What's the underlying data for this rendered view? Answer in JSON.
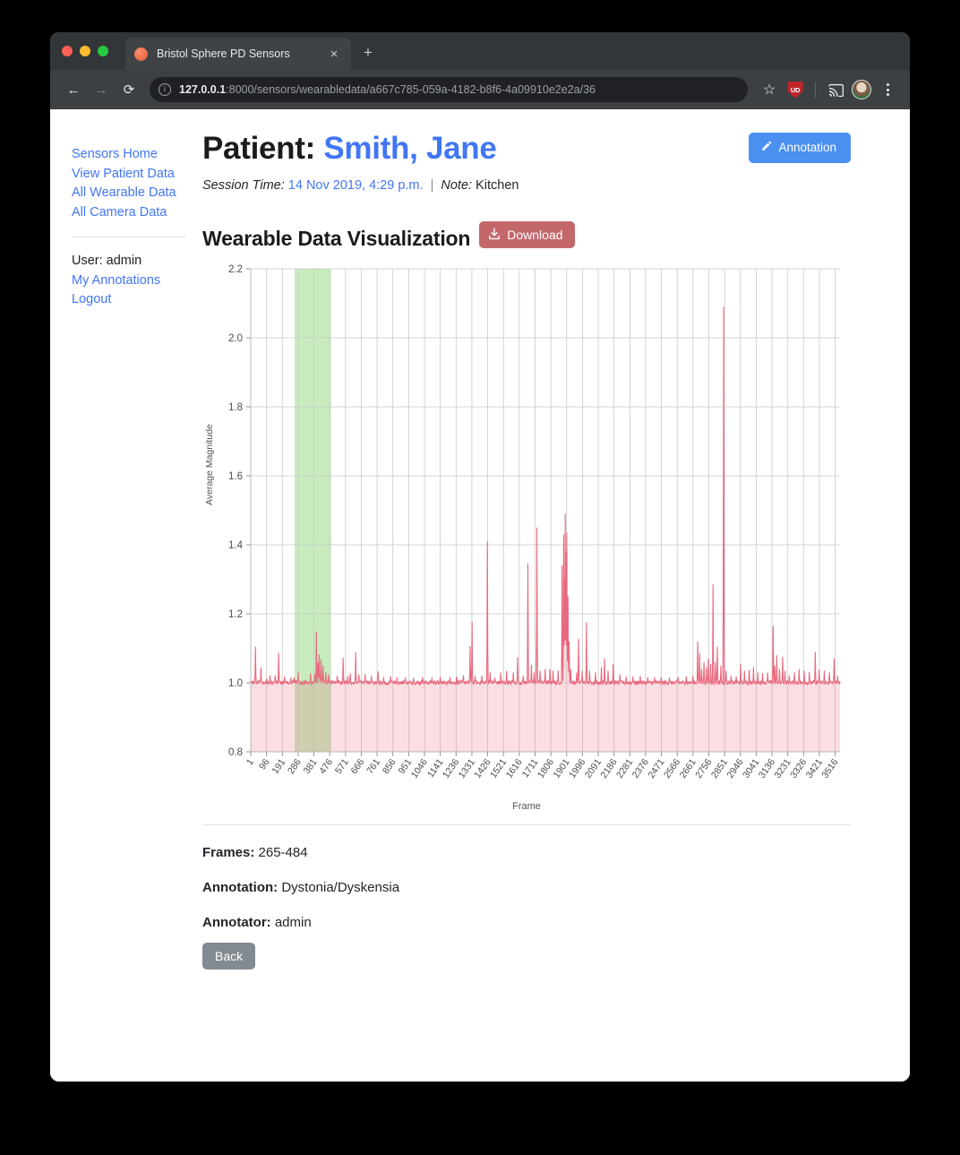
{
  "browser": {
    "tab_title": "Bristol Sphere PD Sensors",
    "tab_close": "×",
    "new_tab": "+",
    "back": "←",
    "forward": "→",
    "reload": "⟳",
    "url_host": "127.0.0.1",
    "url_rest": ":8000/sensors/wearabledata/a667c785-059a-4182-b8f6-4a09910e2e2a/36",
    "star": "☆",
    "extension_badge": "UD",
    "cast": "cast-icon",
    "menu": "kebab-menu"
  },
  "sidebar": {
    "links": [
      {
        "label": "Sensors Home"
      },
      {
        "label": "View Patient Data"
      },
      {
        "label": "All Wearable Data"
      },
      {
        "label": "All Camera Data"
      }
    ],
    "user_line": "User: admin",
    "my_annotations": "My Annotations",
    "logout": "Logout"
  },
  "header": {
    "patient_prefix": "Patient:",
    "patient_name": "Smith, Jane",
    "annotation_button": "Annotation",
    "session_label": "Session Time:",
    "session_time": "14 Nov 2019, 4:29 p.m.",
    "separator": "|",
    "note_label": "Note:",
    "note_value": "Kitchen"
  },
  "viz": {
    "title": "Wearable Data Visualization",
    "download_button": "Download"
  },
  "details": {
    "frames_label": "Frames:",
    "frames_value": "265-484",
    "annotation_label": "Annotation:",
    "annotation_value": "Dystonia/Dyskensia",
    "annotator_label": "Annotator:",
    "annotator_value": "admin",
    "back_button": "Back"
  },
  "colors": {
    "link_blue": "#4176f4",
    "annotation_blue": "#4b90f0",
    "download_red": "#c4676b",
    "back_gray": "#838a91",
    "series_line": "#e8697d",
    "series_fill": "#f7dcdf",
    "highlight_green": "#b6e6a8"
  },
  "chart_data": {
    "type": "line",
    "title": "",
    "xlabel": "Frame",
    "ylabel": "Average Magnitude",
    "ylim": [
      0.8,
      2.2
    ],
    "yticks": [
      0.8,
      1.0,
      1.2,
      1.4,
      1.6,
      1.8,
      2.0,
      2.2
    ],
    "ytick_labels": [
      "0.8",
      "1.0",
      "1.2",
      "1.4",
      "1.6",
      "1.8",
      "2.0",
      "2.2"
    ],
    "xlim": [
      1,
      3545
    ],
    "xticks": [
      1,
      96,
      191,
      286,
      381,
      476,
      571,
      666,
      761,
      856,
      951,
      1046,
      1141,
      1236,
      1331,
      1426,
      1521,
      1616,
      1711,
      1806,
      1901,
      1996,
      2091,
      2186,
      2281,
      2376,
      2471,
      2566,
      2661,
      2756,
      2851,
      2946,
      3041,
      3136,
      3231,
      3326,
      3421,
      3516
    ],
    "xtick_labels": [
      "1",
      "96",
      "191",
      "286",
      "381",
      "476",
      "571",
      "666",
      "761",
      "856",
      "951",
      "1046",
      "1141",
      "1236",
      "1331",
      "1426",
      "1521",
      "1616",
      "1711",
      "1806",
      "1901",
      "1996",
      "2091",
      "2186",
      "2281",
      "2376",
      "2471",
      "2566",
      "2661",
      "2756",
      "2851",
      "2946",
      "3041",
      "3136",
      "3231",
      "3326",
      "3421",
      "3516"
    ],
    "grid": true,
    "legend": null,
    "baseline": 1.0,
    "fill_to": 0.8,
    "highlight_region": {
      "start": 265,
      "end": 484,
      "color": "#b6e6a8",
      "label": "annotated frames 265-484"
    },
    "series": [
      {
        "name": "Average Magnitude",
        "color": "#e8697d",
        "peaks": [
          [
            30,
            1.105
          ],
          [
            63,
            1.045
          ],
          [
            97,
            1.012
          ],
          [
            118,
            1.022
          ],
          [
            148,
            1.022
          ],
          [
            168,
            1.087
          ],
          [
            205,
            1.018
          ],
          [
            243,
            1.015
          ],
          [
            262,
            1.016
          ],
          [
            288,
            1.03
          ],
          [
            330,
            1.008
          ],
          [
            360,
            1.028
          ],
          [
            387,
            1.025
          ],
          [
            395,
            1.148
          ],
          [
            405,
            1.06
          ],
          [
            412,
            1.082
          ],
          [
            424,
            1.068
          ],
          [
            437,
            1.05
          ],
          [
            452,
            1.03
          ],
          [
            470,
            1.024
          ],
          [
            520,
            1.02
          ],
          [
            556,
            1.072
          ],
          [
            584,
            1.02
          ],
          [
            600,
            1.028
          ],
          [
            633,
            1.088
          ],
          [
            650,
            1.024
          ],
          [
            690,
            1.025
          ],
          [
            726,
            1.02
          ],
          [
            766,
            1.033
          ],
          [
            800,
            1.016
          ],
          [
            842,
            1.019
          ],
          [
            880,
            1.016
          ],
          [
            930,
            1.015
          ],
          [
            980,
            1.014
          ],
          [
            1035,
            1.016
          ],
          [
            1090,
            1.015
          ],
          [
            1140,
            1.017
          ],
          [
            1200,
            1.016
          ],
          [
            1240,
            1.018
          ],
          [
            1280,
            1.022
          ],
          [
            1320,
            1.106
          ],
          [
            1333,
            1.178
          ],
          [
            1352,
            1.02
          ],
          [
            1390,
            1.02
          ],
          [
            1424,
            1.41
          ],
          [
            1440,
            1.03
          ],
          [
            1470,
            1.015
          ],
          [
            1505,
            1.03
          ],
          [
            1540,
            1.035
          ],
          [
            1580,
            1.03
          ],
          [
            1606,
            1.075
          ],
          [
            1640,
            1.02
          ],
          [
            1668,
            1.346
          ],
          [
            1690,
            1.052
          ],
          [
            1705,
            1.03
          ],
          [
            1722,
            1.45
          ],
          [
            1740,
            1.035
          ],
          [
            1772,
            1.04
          ],
          [
            1800,
            1.04
          ],
          [
            1820,
            1.035
          ],
          [
            1850,
            1.035
          ],
          [
            1874,
            1.34
          ],
          [
            1882,
            1.43
          ],
          [
            1888,
            1.3
          ],
          [
            1893,
            1.49
          ],
          [
            1898,
            1.38
          ],
          [
            1903,
            1.435
          ],
          [
            1908,
            1.25
          ],
          [
            1915,
            1.12
          ],
          [
            1925,
            1.04
          ],
          [
            1960,
            1.03
          ],
          [
            1972,
            1.128
          ],
          [
            1995,
            1.035
          ],
          [
            2020,
            1.175
          ],
          [
            2040,
            1.035
          ],
          [
            2075,
            1.03
          ],
          [
            2110,
            1.045
          ],
          [
            2128,
            1.07
          ],
          [
            2150,
            1.035
          ],
          [
            2180,
            1.055
          ],
          [
            2220,
            1.025
          ],
          [
            2260,
            1.018
          ],
          [
            2300,
            1.018
          ],
          [
            2345,
            1.02
          ],
          [
            2390,
            1.016
          ],
          [
            2430,
            1.015
          ],
          [
            2470,
            1.016
          ],
          [
            2520,
            1.015
          ],
          [
            2570,
            1.016
          ],
          [
            2620,
            1.018
          ],
          [
            2660,
            1.02
          ],
          [
            2690,
            1.12
          ],
          [
            2700,
            1.085
          ],
          [
            2712,
            1.04
          ],
          [
            2728,
            1.06
          ],
          [
            2740,
            1.045
          ],
          [
            2752,
            1.07
          ],
          [
            2766,
            1.055
          ],
          [
            2782,
            1.285
          ],
          [
            2795,
            1.06
          ],
          [
            2808,
            1.105
          ],
          [
            2828,
            1.05
          ],
          [
            2845,
            2.09
          ],
          [
            2860,
            1.035
          ],
          [
            2890,
            1.02
          ],
          [
            2920,
            1.018
          ],
          [
            2948,
            1.055
          ],
          [
            2970,
            1.035
          ],
          [
            3000,
            1.038
          ],
          [
            3025,
            1.045
          ],
          [
            3050,
            1.03
          ],
          [
            3080,
            1.028
          ],
          [
            3110,
            1.03
          ],
          [
            3142,
            1.165
          ],
          [
            3152,
            1.05
          ],
          [
            3165,
            1.08
          ],
          [
            3180,
            1.04
          ],
          [
            3200,
            1.075
          ],
          [
            3215,
            1.035
          ],
          [
            3240,
            1.02
          ],
          [
            3270,
            1.03
          ],
          [
            3300,
            1.04
          ],
          [
            3330,
            1.035
          ],
          [
            3360,
            1.032
          ],
          [
            3395,
            1.09
          ],
          [
            3420,
            1.038
          ],
          [
            3450,
            1.035
          ],
          [
            3480,
            1.03
          ],
          [
            3510,
            1.07
          ],
          [
            3530,
            1.02
          ]
        ]
      }
    ]
  }
}
